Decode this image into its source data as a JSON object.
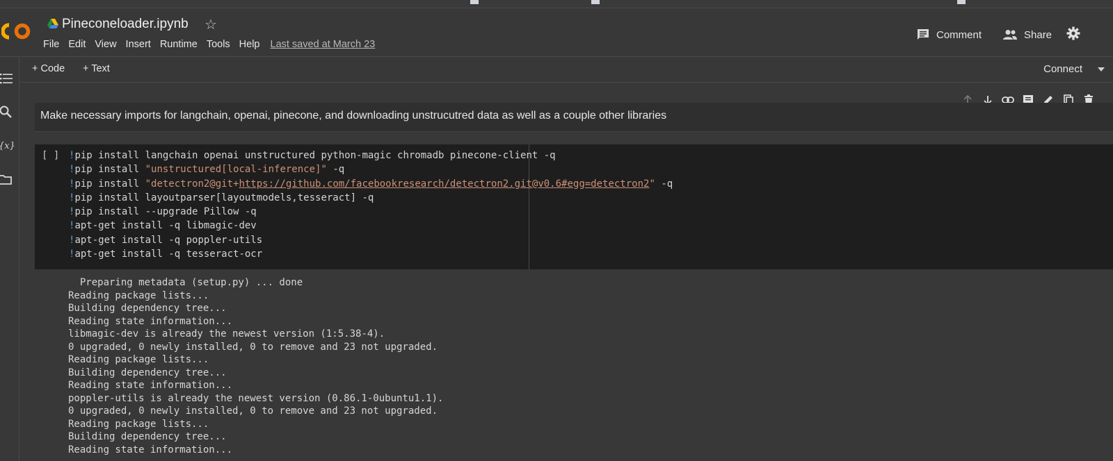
{
  "header": {
    "notebook_title": "Pineconeloader.ipynb",
    "menu": [
      "File",
      "Edit",
      "View",
      "Insert",
      "Runtime",
      "Tools",
      "Help"
    ],
    "last_saved": "Last saved at March 23",
    "comment_label": "Comment",
    "share_label": "Share"
  },
  "toolbar": {
    "add_code_label": "+ Code",
    "add_text_label": "+ Text",
    "connect_label": "Connect"
  },
  "colors": {
    "background": "#383838",
    "code_background": "#1e1e1e",
    "text_cell_background": "#2f2f2f",
    "logo_orange": "#f9ab00",
    "string_color": "#ce9178"
  },
  "text_cell": {
    "content": "Make necessary imports for langchain, openai, pinecone, and downloading unstrucutred data as well as a couple other libraries"
  },
  "code_cell": {
    "run_indicator": "[ ]",
    "lines": [
      [
        {
          "t": "!",
          "c": "bang"
        },
        {
          "t": "pip install langchain openai unstructured python-magic chromadb pinecone-client -q",
          "c": ""
        }
      ],
      [
        {
          "t": "!",
          "c": "bang"
        },
        {
          "t": "pip install ",
          "c": ""
        },
        {
          "t": "\"unstructured[local-inference]\"",
          "c": "str"
        },
        {
          "t": " -q",
          "c": ""
        }
      ],
      [
        {
          "t": "!",
          "c": "bang"
        },
        {
          "t": "pip install ",
          "c": ""
        },
        {
          "t": "\"detectron2@git+",
          "c": "str"
        },
        {
          "t": "https://github.com/facebookresearch/detectron2.git@v0.6#egg=detectron2",
          "c": "url"
        },
        {
          "t": "\"",
          "c": "str"
        },
        {
          "t": " -q",
          "c": ""
        }
      ],
      [
        {
          "t": "!",
          "c": "bang"
        },
        {
          "t": "pip install layoutparser[layoutmodels,tesseract] -q",
          "c": ""
        }
      ],
      [
        {
          "t": "!",
          "c": "bang"
        },
        {
          "t": "pip install --upgrade Pillow -q",
          "c": ""
        }
      ],
      [
        {
          "t": "!",
          "c": "bang"
        },
        {
          "t": "apt-get install -q libmagic-dev",
          "c": ""
        }
      ],
      [
        {
          "t": "!",
          "c": "bang"
        },
        {
          "t": "apt-get install -q poppler-utils",
          "c": ""
        }
      ],
      [
        {
          "t": "!",
          "c": "bang"
        },
        {
          "t": "apt-get install -q tesseract-ocr",
          "c": ""
        }
      ]
    ]
  },
  "output": [
    "  Preparing metadata (setup.py) ... done",
    "Reading package lists...",
    "Building dependency tree...",
    "Reading state information...",
    "libmagic-dev is already the newest version (1:5.38-4).",
    "0 upgraded, 0 newly installed, 0 to remove and 23 not upgraded.",
    "Reading package lists...",
    "Building dependency tree...",
    "Reading state information...",
    "poppler-utils is already the newest version (0.86.1-0ubuntu1.1).",
    "0 upgraded, 0 newly installed, 0 to remove and 23 not upgraded.",
    "Reading package lists...",
    "Building dependency tree...",
    "Reading state information..."
  ]
}
